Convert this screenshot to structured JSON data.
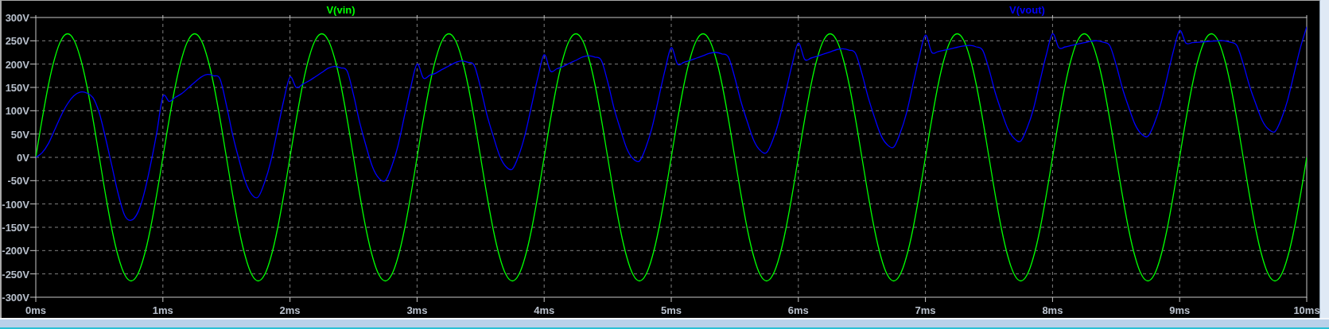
{
  "plot": {
    "chart_data": {
      "type": "line",
      "x": [
        0,
        0.05,
        0.1,
        0.15,
        0.2,
        0.25,
        0.3,
        0.35,
        0.4,
        0.45,
        0.5,
        0.55,
        0.6,
        0.65,
        0.7,
        0.75,
        0.8,
        0.85,
        0.9,
        0.95,
        1,
        1.05,
        1.1,
        1.15,
        1.2,
        1.25,
        1.3,
        1.35,
        1.4,
        1.45,
        1.5,
        1.55,
        1.6,
        1.65,
        1.7,
        1.75,
        1.8,
        1.85,
        1.9,
        1.95,
        2,
        2.05,
        2.1,
        2.15,
        2.2,
        2.25,
        2.3,
        2.35,
        2.4,
        2.45,
        2.5,
        2.55,
        2.6,
        2.65,
        2.7,
        2.75,
        2.8,
        2.85,
        2.9,
        2.95,
        3,
        3.05,
        3.1,
        3.15,
        3.2,
        3.25,
        3.3,
        3.35,
        3.4,
        3.45,
        3.5,
        3.55,
        3.6,
        3.65,
        3.7,
        3.75,
        3.8,
        3.85,
        3.9,
        3.95,
        4,
        4.05,
        4.1,
        4.15,
        4.2,
        4.25,
        4.3,
        4.35,
        4.4,
        4.45,
        4.5,
        4.55,
        4.6,
        4.65,
        4.7,
        4.75,
        4.8,
        4.85,
        4.9,
        4.95,
        5,
        5.05,
        5.1,
        5.15,
        5.2,
        5.25,
        5.3,
        5.35,
        5.4,
        5.45,
        5.5,
        5.55,
        5.6,
        5.65,
        5.7,
        5.75,
        5.8,
        5.85,
        5.9,
        5.95,
        6,
        6.05,
        6.1,
        6.15,
        6.2,
        6.25,
        6.3,
        6.35,
        6.4,
        6.45,
        6.5,
        6.55,
        6.6,
        6.65,
        6.7,
        6.75,
        6.8,
        6.85,
        6.9,
        6.95,
        7,
        7.05,
        7.1,
        7.15,
        7.2,
        7.25,
        7.3,
        7.35,
        7.4,
        7.45,
        7.5,
        7.55,
        7.6,
        7.65,
        7.7,
        7.75,
        7.8,
        7.85,
        7.9,
        7.95,
        8,
        8.05,
        8.1,
        8.15,
        8.2,
        8.25,
        8.3,
        8.35,
        8.4,
        8.45,
        8.5,
        8.55,
        8.6,
        8.65,
        8.7,
        8.75,
        8.8,
        8.85,
        8.9,
        8.95,
        9,
        9.05,
        9.1,
        9.15,
        9.2,
        9.25,
        9.3,
        9.35,
        9.4,
        9.45,
        9.5,
        9.55,
        9.6,
        9.65,
        9.7,
        9.75,
        9.8,
        9.85,
        9.9,
        9.95,
        10
      ],
      "series": [
        {
          "name": "V(vin)",
          "color": "#00ff00",
          "values": [
            0,
            82,
            156,
            214,
            252,
            265,
            252,
            214,
            156,
            82,
            0,
            -82,
            -156,
            -214,
            -252,
            -265,
            -252,
            -214,
            -156,
            -82,
            0,
            82,
            156,
            214,
            252,
            265,
            252,
            214,
            156,
            82,
            0,
            -82,
            -156,
            -214,
            -252,
            -265,
            -252,
            -214,
            -156,
            -82,
            0,
            82,
            156,
            214,
            252,
            265,
            252,
            214,
            156,
            82,
            0,
            -82,
            -156,
            -214,
            -252,
            -265,
            -252,
            -214,
            -156,
            -82,
            0,
            82,
            156,
            214,
            252,
            265,
            252,
            214,
            156,
            82,
            0,
            -82,
            -156,
            -214,
            -252,
            -265,
            -252,
            -214,
            -156,
            -82,
            0,
            82,
            156,
            214,
            252,
            265,
            252,
            214,
            156,
            82,
            0,
            -82,
            -156,
            -214,
            -252,
            -265,
            -252,
            -214,
            -156,
            -82,
            0,
            82,
            156,
            214,
            252,
            265,
            252,
            214,
            156,
            82,
            0,
            -82,
            -156,
            -214,
            -252,
            -265,
            -252,
            -214,
            -156,
            -82,
            0,
            82,
            156,
            214,
            252,
            265,
            252,
            214,
            156,
            82,
            0,
            -82,
            -156,
            -214,
            -252,
            -265,
            -252,
            -214,
            -156,
            -82,
            0,
            82,
            156,
            214,
            252,
            265,
            252,
            214,
            156,
            82,
            0,
            -82,
            -156,
            -214,
            -252,
            -265,
            -252,
            -214,
            -156,
            -82,
            0,
            82,
            156,
            214,
            252,
            265,
            252,
            214,
            156,
            82,
            0,
            -82,
            -156,
            -214,
            -252,
            -265,
            -252,
            -214,
            -156,
            -82,
            0,
            82,
            156,
            214,
            252,
            265,
            252,
            214,
            156,
            82,
            0,
            -82,
            -156,
            -214,
            -252,
            -265,
            -252,
            -214,
            -156,
            -82,
            0
          ]
        },
        {
          "name": "V(vout)",
          "color": "#0000ff",
          "values": [
            0,
            10,
            30,
            60,
            90,
            115,
            132,
            140,
            138,
            128,
            95,
            40,
            -20,
            -80,
            -125,
            -135,
            -120,
            -80,
            -20,
            50,
            130,
            120,
            129,
            137,
            149,
            161,
            172,
            178,
            175,
            168,
            112,
            47,
            -6,
            -53,
            -80,
            -85,
            -54,
            -8,
            56,
            121,
            172,
            150,
            157,
            164,
            173,
            182,
            191,
            195,
            192,
            185,
            134,
            73,
            23,
            -21,
            -45,
            -50,
            -20,
            25,
            88,
            150,
            200,
            170,
            176,
            181,
            189,
            196,
            203,
            207,
            204,
            197,
            149,
            91,
            45,
            3,
            -20,
            -25,
            4,
            49,
            110,
            171,
            220,
            185,
            190,
            195,
            202,
            208,
            215,
            218,
            215,
            208,
            162,
            105,
            60,
            19,
            -3,
            -8,
            21,
            65,
            126,
            186,
            235,
            200,
            204,
            208,
            213,
            218,
            223,
            225,
            222,
            215,
            171,
            118,
            75,
            36,
            15,
            10,
            38,
            81,
            139,
            198,
            245,
            210,
            213,
            217,
            222,
            226,
            231,
            233,
            230,
            223,
            180,
            128,
            85,
            47,
            27,
            22,
            51,
            94,
            154,
            214,
            262,
            225,
            227,
            230,
            233,
            236,
            239,
            240,
            237,
            230,
            189,
            138,
            97,
            60,
            40,
            35,
            63,
            104,
            162,
            219,
            265,
            235,
            237,
            240,
            243,
            246,
            249,
            250,
            247,
            240,
            199,
            148,
            107,
            70,
            50,
            45,
            72,
            113,
            170,
            227,
            272,
            245,
            246,
            247,
            248,
            249,
            250,
            250,
            247,
            240,
            201,
            153,
            114,
            79,
            60,
            55,
            82,
            123,
            179,
            235,
            280
          ]
        }
      ],
      "xlim": [
        0,
        10
      ],
      "ylim": [
        -300,
        300
      ],
      "grid": true,
      "xticks": [
        {
          "value": 0,
          "label": "0ms"
        },
        {
          "value": 1,
          "label": "1ms"
        },
        {
          "value": 2,
          "label": "2ms"
        },
        {
          "value": 3,
          "label": "3ms"
        },
        {
          "value": 4,
          "label": "4ms"
        },
        {
          "value": 5,
          "label": "5ms"
        },
        {
          "value": 6,
          "label": "6ms"
        },
        {
          "value": 7,
          "label": "7ms"
        },
        {
          "value": 8,
          "label": "8ms"
        },
        {
          "value": 9,
          "label": "9ms"
        },
        {
          "value": 10,
          "label": "10ms"
        }
      ],
      "yticks": [
        {
          "value": 300,
          "label": "300V"
        },
        {
          "value": 250,
          "label": "250V"
        },
        {
          "value": 200,
          "label": "200V"
        },
        {
          "value": 150,
          "label": "150V"
        },
        {
          "value": 100,
          "label": "100V"
        },
        {
          "value": 50,
          "label": "50V"
        },
        {
          "value": 0,
          "label": "0V"
        },
        {
          "value": -50,
          "label": "-50V"
        },
        {
          "value": -100,
          "label": "-100V"
        },
        {
          "value": -150,
          "label": "-150V"
        },
        {
          "value": -200,
          "label": "-200V"
        },
        {
          "value": -250,
          "label": "-250V"
        },
        {
          "value": -300,
          "label": "-300V"
        }
      ]
    }
  }
}
